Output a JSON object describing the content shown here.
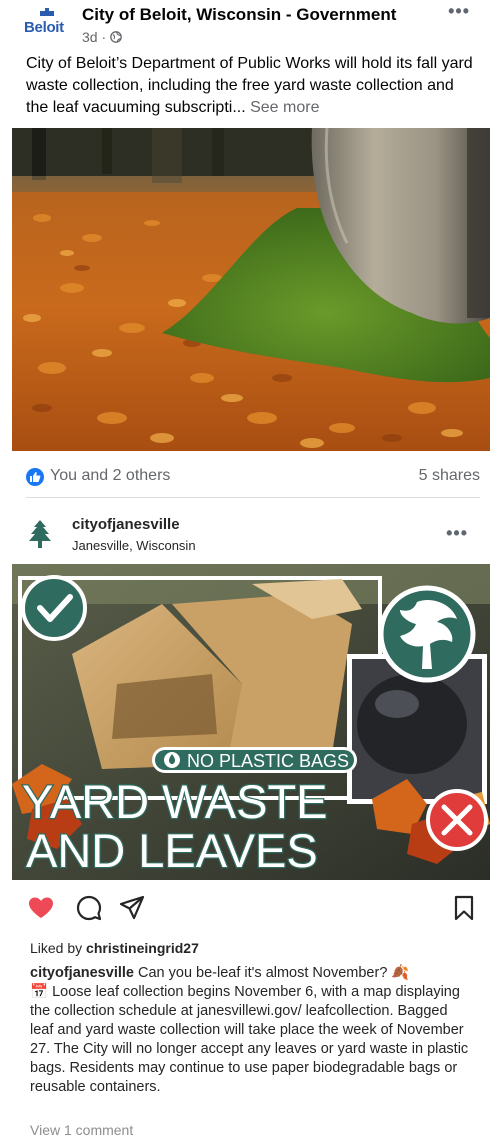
{
  "facebook_post": {
    "logo_text": "Beloit",
    "page_name": "City of Beloit, Wisconsin - Government",
    "time": "3d · ",
    "text": "City of Beloit’s Department of Public Works will hold its fall yard waste collection, including the free yard waste collection and the leaf vacuuming subscripti... ",
    "see_more": "See more",
    "reactions": "You and 2 others",
    "shares": "5 shares"
  },
  "instagram_post": {
    "username": "cityofjanesville",
    "location": "Janesville, Wisconsin",
    "image_badge": "NO PLASTIC BAGS",
    "image_title_line1": "YARD WASTE",
    "image_title_line2": "AND LEAVES",
    "liked_by_prefix": "Liked by ",
    "liked_by_user": "christineingrid27",
    "caption_user": "cityofjanesville",
    "caption_part1": " Can you be-leaf it's almost November? 🍂",
    "caption_part2": "📅 Loose leaf collection begins November 6, with a map displaying the collection schedule at janesvillewi.gov/ leafcollection. Bagged leaf and yard waste collection will take place the week of November 27. The City will no longer accept any leaves or yard waste in plastic bags. Residents may continue to use paper biodegradable bags or reusable containers.",
    "view_comments": "View 1 comment"
  },
  "colors": {
    "fb_blue": "#1877f2",
    "beloit_blue": "#2a5db0",
    "janesville_green": "#2f6b5e",
    "like_red": "#ed4956"
  }
}
